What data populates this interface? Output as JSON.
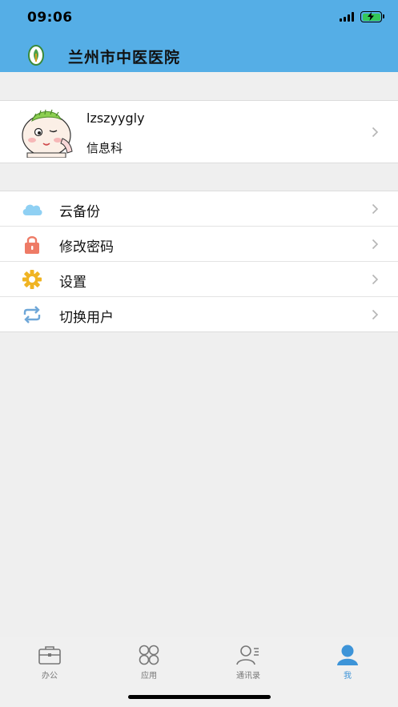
{
  "status_bar": {
    "time": "09:06"
  },
  "header": {
    "title": "兰州市中医医院",
    "logo": "hospital-logo"
  },
  "profile": {
    "username": "lzszyygly",
    "department": "信息科",
    "avatar": "cartoon-avatar"
  },
  "menu": [
    {
      "label": "云备份",
      "icon": "cloud-icon",
      "color": "#8fd0f3"
    },
    {
      "label": "修改密码",
      "icon": "lock-icon",
      "color": "#ee7b66"
    },
    {
      "label": "设置",
      "icon": "gear-icon",
      "color": "#f0b423"
    },
    {
      "label": "切换用户",
      "icon": "switch-user-icon",
      "color": "#6fa7d8"
    }
  ],
  "tabs": [
    {
      "label": "办公",
      "icon": "briefcase-icon",
      "active": false
    },
    {
      "label": "应用",
      "icon": "apps-icon",
      "active": false
    },
    {
      "label": "通讯录",
      "icon": "contacts-icon",
      "active": false
    },
    {
      "label": "我",
      "icon": "person-icon",
      "active": true
    }
  ],
  "colors": {
    "header_bg": "#55aee6",
    "page_bg": "#efefef",
    "active_tab": "#3d94d8",
    "inactive_tab": "#777777"
  }
}
